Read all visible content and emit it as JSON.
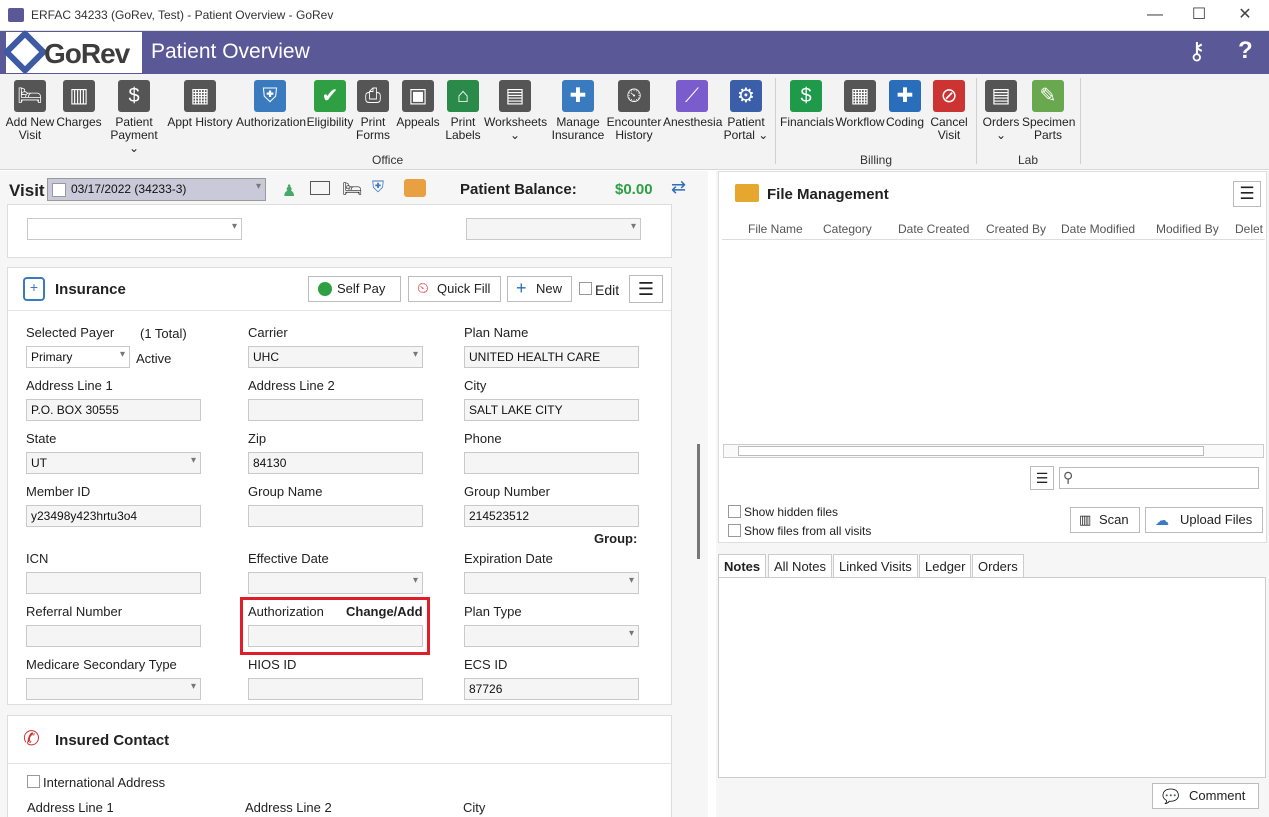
{
  "window": {
    "title": "ERFAC 34233 (GoRev, Test) - Patient Overview - GoRev",
    "min": "—",
    "max": "☐",
    "close": "✕"
  },
  "header": {
    "logo": "GoRev",
    "title": "Patient Overview",
    "keys_icon": "⚷",
    "help": "?"
  },
  "ribbon": {
    "office": [
      {
        "label": "Add New\nVisit",
        "icon": "bed-plus-icon"
      },
      {
        "label": "Charges",
        "icon": "barcode-icon"
      },
      {
        "label": "Patient\nPayment ⌄",
        "icon": "payment-icon"
      },
      {
        "label": "Appt History",
        "icon": "calendar-icon"
      },
      {
        "label": "Authorization",
        "icon": "shield-check-icon"
      },
      {
        "label": "Eligibility",
        "icon": "user-check-icon"
      },
      {
        "label": "Print\nForms",
        "icon": "printer-icon"
      },
      {
        "label": "Appeals",
        "icon": "briefcase-icon"
      },
      {
        "label": "Print\nLabels",
        "icon": "tag-icon"
      },
      {
        "label": "Worksheets\n⌄",
        "icon": "worksheets-icon"
      },
      {
        "label": "Manage\nInsurance",
        "icon": "insurance-icon"
      },
      {
        "label": "Encounter\nHistory",
        "icon": "encounter-icon"
      },
      {
        "label": "Anesthesia",
        "icon": "syringe-icon"
      },
      {
        "label": "Patient\nPortal ⌄",
        "icon": "globe-icon"
      }
    ],
    "billing": [
      {
        "label": "Financials",
        "icon": "dollar-icon"
      },
      {
        "label": "Workflow",
        "icon": "workflow-icon"
      },
      {
        "label": "Coding",
        "icon": "book-plus-icon"
      },
      {
        "label": "Cancel\nVisit",
        "icon": "cancel-clock-icon"
      }
    ],
    "lab": [
      {
        "label": "Orders\n⌄",
        "icon": "orders-icon"
      },
      {
        "label": "Specimen\nParts",
        "icon": "specimen-icon"
      }
    ],
    "groups": {
      "office": "Office",
      "billing": "Billing",
      "lab": "Lab"
    }
  },
  "visit": {
    "label": "Visit",
    "value": "03/17/2022 (34233-3)",
    "balance_label": "Patient Balance:",
    "balance": "$0.00"
  },
  "insurance": {
    "title": "Insurance",
    "self_pay": "Self Pay",
    "quick_fill": "Quick Fill",
    "new": "New",
    "edit": "Edit",
    "selected_payer_label": "Selected Payer",
    "total": "(1 Total)",
    "selected_payer": "Primary",
    "active": "Active",
    "carrier_label": "Carrier",
    "carrier": "UHC",
    "plan_name_label": "Plan Name",
    "plan_name": "UNITED HEALTH CARE",
    "addr1_label": "Address Line 1",
    "addr1": "P.O. BOX 30555",
    "addr2_label": "Address Line 2",
    "addr2": "",
    "city_label": "City",
    "city": "SALT LAKE CITY",
    "state_label": "State",
    "state": "UT",
    "zip_label": "Zip",
    "zip": "84130",
    "phone_label": "Phone",
    "phone": "",
    "member_id_label": "Member ID",
    "member_id": "y23498y423hrtu3o4",
    "group_name_label": "Group Name",
    "group_name": "",
    "group_number_label": "Group Number",
    "group_number": "214523512",
    "group_label": "Group:",
    "icn_label": "ICN",
    "icn": "",
    "eff_date_label": "Effective Date",
    "exp_date_label": "Expiration Date",
    "referral_label": "Referral Number",
    "auth_label": "Authorization",
    "change_add": "Change/Add",
    "plan_type_label": "Plan Type",
    "medicare_label": "Medicare Secondary Type",
    "hios_label": "HIOS ID",
    "ecs_label": "ECS ID",
    "ecs": "87726"
  },
  "insured": {
    "title": "Insured Contact",
    "intl": "International Address",
    "addr1": "Address Line 1",
    "addr2": "Address Line 2",
    "city": "City"
  },
  "files": {
    "title": "File Management",
    "columns": [
      "File Name",
      "Category",
      "Date Created",
      "Created By",
      "Date Modified",
      "Modified By",
      "Delet"
    ],
    "hidden": "Show hidden files",
    "all": "Show files from all visits",
    "scan": "Scan",
    "upload": "Upload Files"
  },
  "notes_tabs": [
    "Notes",
    "All Notes",
    "Linked Visits",
    "Ledger",
    "Orders"
  ],
  "comment": "Comment",
  "colors": {
    "brand": "#5b5897",
    "green": "#2ea043",
    "highlight": "#e01e2b"
  }
}
